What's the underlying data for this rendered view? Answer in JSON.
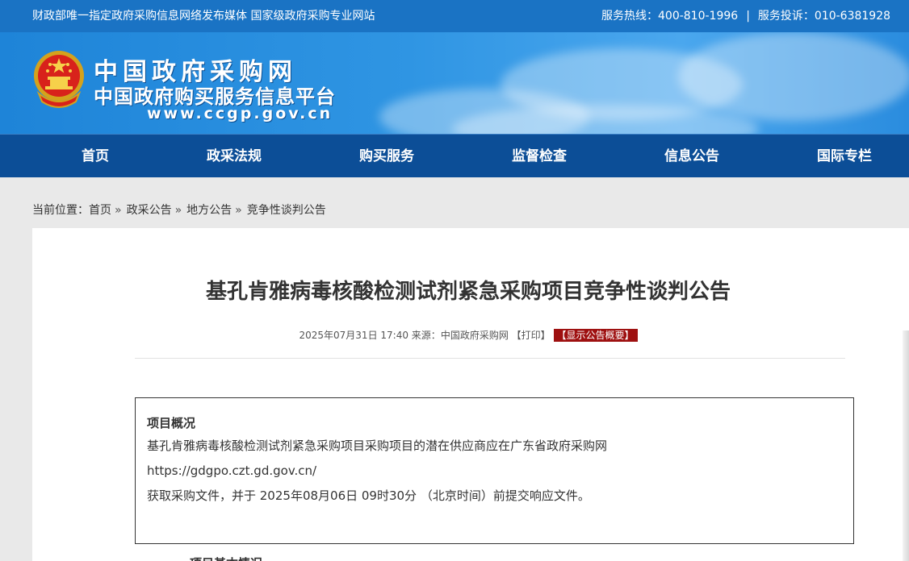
{
  "topbar": {
    "tagline": "财政部唯一指定政府采购信息网络发布媒体 国家级政府采购专业网站",
    "hotline": "服务热线：400-810-1996",
    "separator": "|",
    "complaint": "服务投诉：010-6381928"
  },
  "banner": {
    "site_name": "中国政府采购网",
    "platform_name": "中国政府购买服务信息平台",
    "site_url": "www.ccgp.gov.cn",
    "emblem_icon": "national-emblem-icon"
  },
  "nav": {
    "items": [
      {
        "label": "首页"
      },
      {
        "label": "政采法规"
      },
      {
        "label": "购买服务"
      },
      {
        "label": "监督检查"
      },
      {
        "label": "信息公告"
      },
      {
        "label": "国际专栏"
      }
    ]
  },
  "breadcrumb": {
    "prefix": "当前位置：",
    "items": [
      {
        "label": "首页"
      },
      {
        "label": "政采公告"
      },
      {
        "label": "地方公告"
      },
      {
        "label": "竞争性谈判公告"
      }
    ],
    "arrow": "»"
  },
  "article": {
    "title": "基孔肯雅病毒核酸检测试剂紧急采购项目竞争性谈判公告",
    "datetime": "2025年07月31日 17:40",
    "source_label": "来源：",
    "source": "中国政府采购网",
    "print_label": "【打印】",
    "summary_label": "【显示公告概要】"
  },
  "overview": {
    "heading": "项目概况",
    "lines": [
      "基孔肯雅病毒核酸检测试剂紧急采购项目采购项目的潜在供应商应在广东省政府采购网",
      "https://gdgpo.czt.gd.gov.cn/",
      "获取采购文件，并于 2025年08月06日 09时30分 （北京时间）前提交响应文件。"
    ],
    "next_heading": "一、项目基本情况"
  },
  "colors": {
    "topbar": "#1a73c4",
    "nav": "#0c4e97",
    "summary_button": "#9e1010",
    "page_bg": "#e9e9e9"
  }
}
